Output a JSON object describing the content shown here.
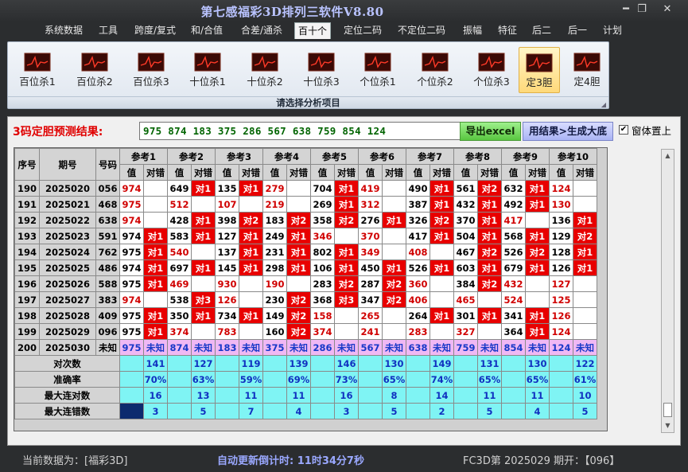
{
  "window": {
    "title": "第七感福彩3D排列三软件V8.80",
    "minimize": "━",
    "restore": "❐",
    "close": "✕"
  },
  "menu": [
    "系统数据",
    "工具",
    "跨度/复式",
    "和/合值",
    "合差/通杀",
    "百十个",
    "定位二码",
    "不定位二码",
    "振幅",
    "特征",
    "后二",
    "后一",
    "计划"
  ],
  "menu_active": 5,
  "ribbon": {
    "items": [
      "百位杀1",
      "百位杀2",
      "百位杀3",
      "十位杀1",
      "十位杀2",
      "十位杀3",
      "个位杀1",
      "个位杀2",
      "个位杀3",
      "定3胆",
      "定4胆"
    ],
    "selected": 9,
    "footer": "请选择分析项目"
  },
  "prediction": {
    "label": "3码定胆预测结果:",
    "value": "975 874 183 375 286 567 638 759 854 124"
  },
  "buttons": {
    "excel": "导出excel",
    "generate": "用结果>生成大底",
    "pin_label": "窗体置上",
    "pin_checked": "✔"
  },
  "table": {
    "headers": {
      "seq": "序号",
      "period": "期号",
      "code": "号码",
      "refs": [
        "参考1",
        "参考2",
        "参考3",
        "参考4",
        "参考5",
        "参考6",
        "参考7",
        "参考8",
        "参考9",
        "参考10"
      ],
      "val": "值",
      "result": "对错"
    },
    "rows": [
      {
        "seq": "190",
        "period": "2025020",
        "code": "056",
        "cells": [
          [
            "974",
            "r",
            ""
          ],
          [
            "649",
            "",
            "对1"
          ],
          [
            "135",
            "",
            "对1"
          ],
          [
            "279",
            "r",
            ""
          ],
          [
            "704",
            "",
            "对1"
          ],
          [
            "419",
            "r",
            ""
          ],
          [
            "490",
            "",
            "对1"
          ],
          [
            "561",
            "",
            "对2"
          ],
          [
            "632",
            "",
            "对1"
          ],
          [
            "124",
            "r",
            ""
          ]
        ]
      },
      {
        "seq": "191",
        "period": "2025021",
        "code": "468",
        "cells": [
          [
            "975",
            "r",
            ""
          ],
          [
            "512",
            "r",
            ""
          ],
          [
            "107",
            "r",
            ""
          ],
          [
            "219",
            "r",
            ""
          ],
          [
            "269",
            "",
            "对1"
          ],
          [
            "312",
            "r",
            ""
          ],
          [
            "387",
            "",
            "对1"
          ],
          [
            "432",
            "",
            "对1"
          ],
          [
            "492",
            "",
            "对1"
          ],
          [
            "130",
            "r",
            ""
          ]
        ]
      },
      {
        "seq": "192",
        "period": "2025022",
        "code": "638",
        "cells": [
          [
            "974",
            "r",
            ""
          ],
          [
            "428",
            "",
            "对1"
          ],
          [
            "398",
            "",
            "对2"
          ],
          [
            "183",
            "",
            "对2"
          ],
          [
            "358",
            "",
            "对2"
          ],
          [
            "276",
            "",
            "对1"
          ],
          [
            "326",
            "",
            "对2"
          ],
          [
            "370",
            "",
            "对1"
          ],
          [
            "417",
            "r",
            ""
          ],
          [
            "136",
            "",
            "对1"
          ]
        ]
      },
      {
        "seq": "193",
        "period": "2025023",
        "code": "591",
        "cells": [
          [
            "974",
            "",
            "对1"
          ],
          [
            "583",
            "",
            "对1"
          ],
          [
            "127",
            "",
            "对1"
          ],
          [
            "249",
            "",
            "对1"
          ],
          [
            "346",
            "r",
            ""
          ],
          [
            "370",
            "r",
            ""
          ],
          [
            "417",
            "",
            "对1"
          ],
          [
            "504",
            "",
            "对1"
          ],
          [
            "568",
            "",
            "对1"
          ],
          [
            "129",
            "",
            "对2"
          ]
        ]
      },
      {
        "seq": "194",
        "period": "2025024",
        "code": "762",
        "cells": [
          [
            "975",
            "",
            "对1"
          ],
          [
            "540",
            "r",
            ""
          ],
          [
            "137",
            "",
            "对1"
          ],
          [
            "231",
            "",
            "对1"
          ],
          [
            "802",
            "",
            "对1"
          ],
          [
            "349",
            "r",
            ""
          ],
          [
            "408",
            "r",
            ""
          ],
          [
            "467",
            "",
            "对2"
          ],
          [
            "526",
            "",
            "对2"
          ],
          [
            "128",
            "",
            "对1"
          ]
        ]
      },
      {
        "seq": "195",
        "period": "2025025",
        "code": "486",
        "cells": [
          [
            "974",
            "",
            "对1"
          ],
          [
            "697",
            "",
            "对1"
          ],
          [
            "145",
            "",
            "对1"
          ],
          [
            "298",
            "",
            "对1"
          ],
          [
            "106",
            "",
            "对1"
          ],
          [
            "450",
            "",
            "对1"
          ],
          [
            "526",
            "",
            "对1"
          ],
          [
            "603",
            "",
            "对1"
          ],
          [
            "679",
            "",
            "对1"
          ],
          [
            "126",
            "",
            "对1"
          ]
        ]
      },
      {
        "seq": "196",
        "period": "2025026",
        "code": "588",
        "cells": [
          [
            "975",
            "",
            "对1"
          ],
          [
            "469",
            "r",
            ""
          ],
          [
            "930",
            "r",
            ""
          ],
          [
            "190",
            "r",
            ""
          ],
          [
            "283",
            "",
            "对2"
          ],
          [
            "287",
            "",
            "对2"
          ],
          [
            "360",
            "r",
            ""
          ],
          [
            "384",
            "",
            "对2"
          ],
          [
            "432",
            "r",
            ""
          ],
          [
            "127",
            "r",
            ""
          ]
        ]
      },
      {
        "seq": "197",
        "period": "2025027",
        "code": "383",
        "cells": [
          [
            "974",
            "r",
            ""
          ],
          [
            "538",
            "",
            "对3"
          ],
          [
            "126",
            "r",
            ""
          ],
          [
            "230",
            "",
            "对2"
          ],
          [
            "368",
            "",
            "对3"
          ],
          [
            "347",
            "",
            "对2"
          ],
          [
            "406",
            "r",
            ""
          ],
          [
            "465",
            "r",
            ""
          ],
          [
            "524",
            "r",
            ""
          ],
          [
            "125",
            "r",
            ""
          ]
        ]
      },
      {
        "seq": "198",
        "period": "2025028",
        "code": "409",
        "cells": [
          [
            "975",
            "",
            "对1"
          ],
          [
            "350",
            "",
            "对1"
          ],
          [
            "734",
            "",
            "对1"
          ],
          [
            "149",
            "",
            "对2"
          ],
          [
            "158",
            "r",
            ""
          ],
          [
            "265",
            "r",
            ""
          ],
          [
            "264",
            "",
            "对1"
          ],
          [
            "301",
            "",
            "对1"
          ],
          [
            "341",
            "",
            "对1"
          ],
          [
            "126",
            "r",
            ""
          ]
        ]
      },
      {
        "seq": "199",
        "period": "2025029",
        "code": "096",
        "cells": [
          [
            "975",
            "",
            "对1"
          ],
          [
            "374",
            "r",
            ""
          ],
          [
            "783",
            "r",
            ""
          ],
          [
            "160",
            "",
            "对2"
          ],
          [
            "374",
            "r",
            ""
          ],
          [
            "241",
            "r",
            ""
          ],
          [
            "283",
            "r",
            ""
          ],
          [
            "327",
            "r",
            ""
          ],
          [
            "364",
            "",
            "对1"
          ],
          [
            "124",
            "r",
            ""
          ]
        ]
      },
      {
        "seq": "200",
        "period": "2025030",
        "code": "未知",
        "cells": [
          [
            "975",
            "u",
            "未知"
          ],
          [
            "874",
            "u",
            "未知"
          ],
          [
            "183",
            "u",
            "未知"
          ],
          [
            "375",
            "u",
            "未知"
          ],
          [
            "286",
            "u",
            "未知"
          ],
          [
            "567",
            "u",
            "未知"
          ],
          [
            "638",
            "u",
            "未知"
          ],
          [
            "759",
            "u",
            "未知"
          ],
          [
            "854",
            "u",
            "未知"
          ],
          [
            "124",
            "u",
            "未知"
          ]
        ]
      }
    ],
    "stats": [
      {
        "label": "对次数",
        "values": [
          "141",
          "127",
          "119",
          "139",
          "146",
          "130",
          "149",
          "131",
          "130",
          "122"
        ]
      },
      {
        "label": "准确率",
        "values": [
          "70%",
          "63%",
          "59%",
          "69%",
          "73%",
          "65%",
          "74%",
          "65%",
          "65%",
          "61%"
        ]
      },
      {
        "label": "最大连对数",
        "values": [
          "16",
          "13",
          "11",
          "11",
          "16",
          "8",
          "14",
          "11",
          "11",
          "10"
        ]
      },
      {
        "label": "最大连错数",
        "values": [
          "3",
          "5",
          "7",
          "4",
          "3",
          "5",
          "2",
          "5",
          "4",
          "5"
        ]
      }
    ]
  },
  "scrollbar": {
    "up": "▲",
    "down": "▼"
  },
  "status": {
    "current": "当前数据为：[福彩3D]",
    "countdown": "自动更新倒计时:  11时34分7秒",
    "issue": "FC3D第 2025029 期开：【096】"
  },
  "colors": {
    "title": "#b9c3ff",
    "prediction_label": "#e00000",
    "mark_red": "#e80000",
    "unknown_bg": "#f0b8f4",
    "stat_bg": "#7ff4f4",
    "countdown": "#9aa8ff"
  }
}
